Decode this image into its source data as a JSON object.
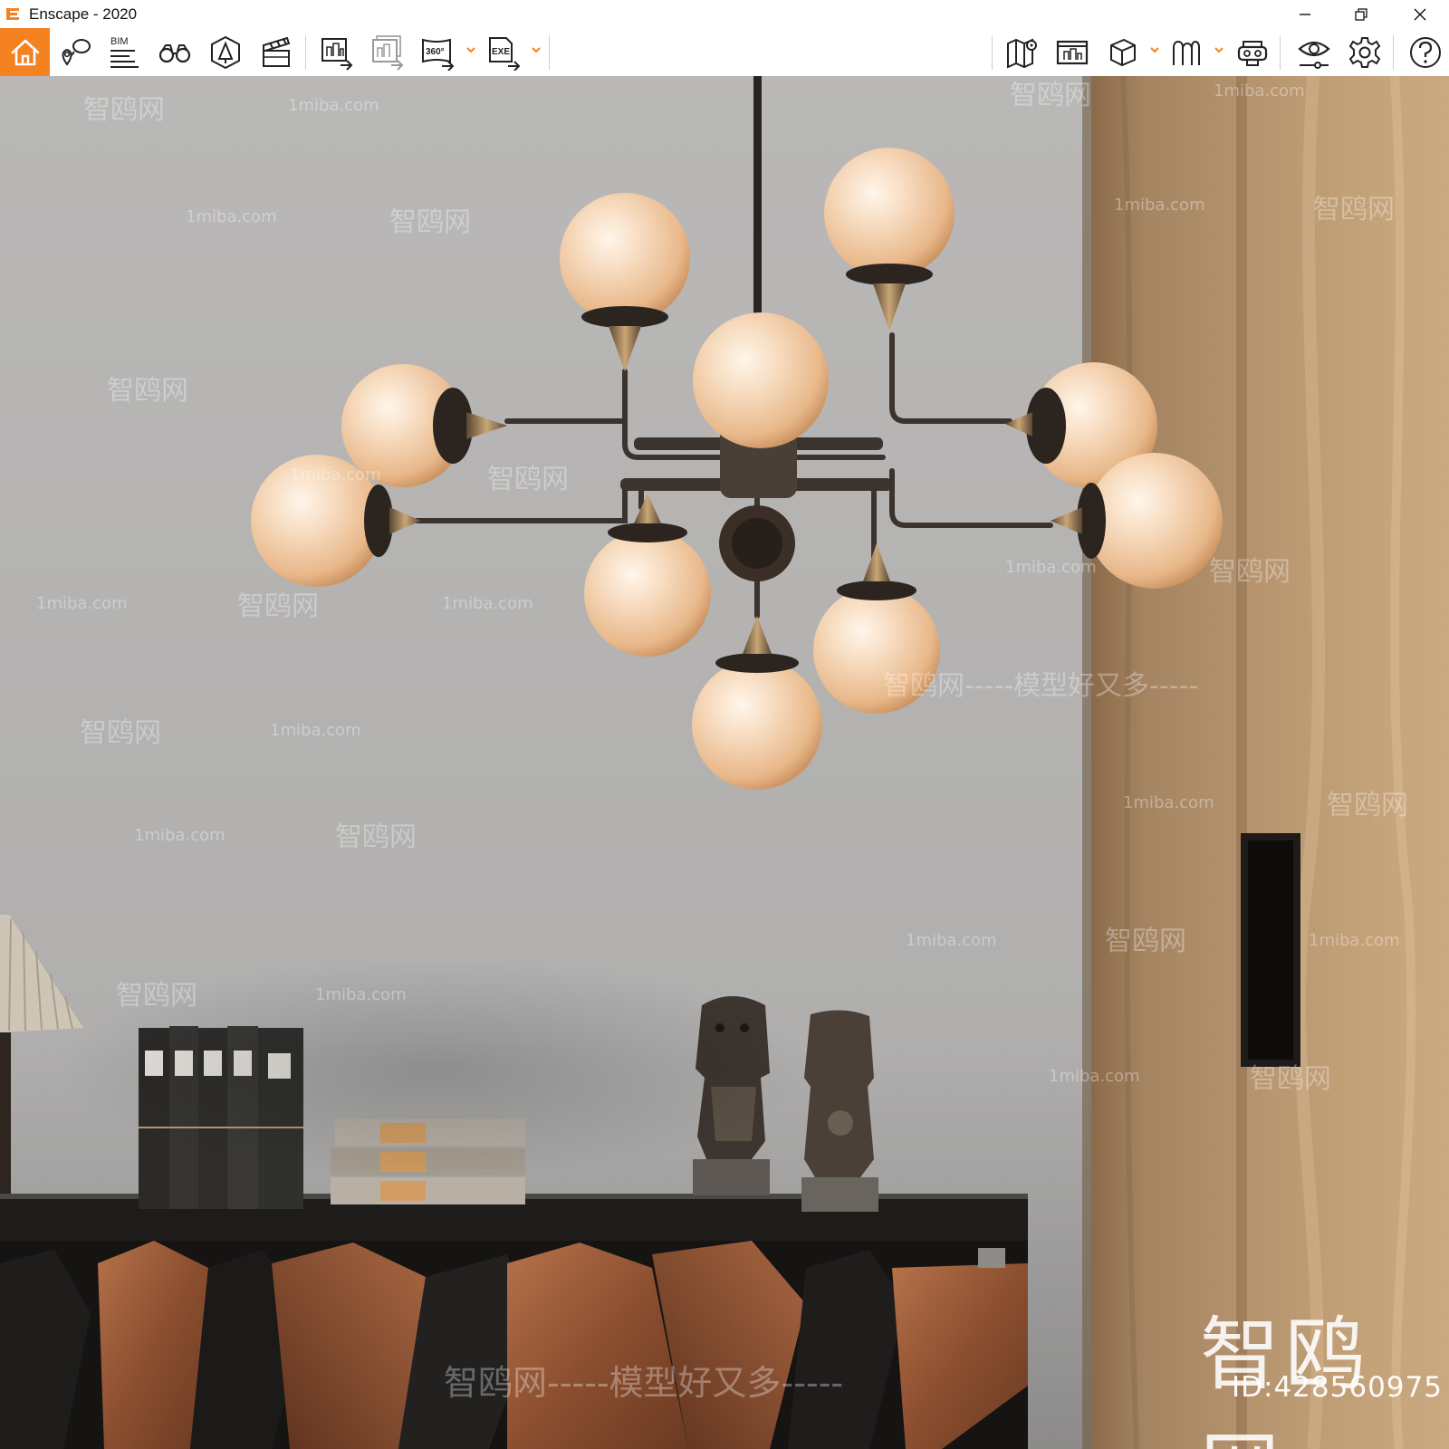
{
  "window": {
    "title": "Enscape - 2020",
    "controls": [
      "minimize",
      "restore",
      "close"
    ]
  },
  "toolbar": {
    "accent_color": "#f58220",
    "left_group": [
      {
        "icon": "home-icon",
        "active": true
      },
      {
        "icon": "views-pin-icon"
      },
      {
        "icon": "bim-icon",
        "text": "BIM"
      },
      {
        "icon": "binoculars-icon"
      },
      {
        "icon": "asset-library-icon"
      },
      {
        "icon": "clapperboard-icon"
      },
      {
        "icon": "render-image-icon"
      },
      {
        "icon": "batch-render-icon"
      },
      {
        "icon": "panorama-360-icon",
        "text": "360°",
        "dropdown": true
      },
      {
        "icon": "export-exe-icon",
        "text": "EXE",
        "dropdown": true
      }
    ],
    "right_group": [
      {
        "icon": "minimap-icon"
      },
      {
        "icon": "screenshot-manager-icon"
      },
      {
        "icon": "cube-view-icon",
        "dropdown": true
      },
      {
        "icon": "vr-headset-icon",
        "dropdown": true
      },
      {
        "icon": "vr-goggles-icon"
      },
      {
        "icon": "visual-settings-eye-icon"
      },
      {
        "icon": "settings-gear-icon"
      },
      {
        "icon": "help-icon"
      }
    ]
  },
  "viewport": {
    "scene": "3D render of a modern chandelier with glass globes above a sideboard with books and bust bookends",
    "watermark_repeat": "智鸥网",
    "watermark_domain": "1miba.com",
    "watermark_slogan": "智鸥网-----模型好又多-----",
    "watermark_logo": "智鸥网",
    "watermark_id": "ID:428560975"
  }
}
